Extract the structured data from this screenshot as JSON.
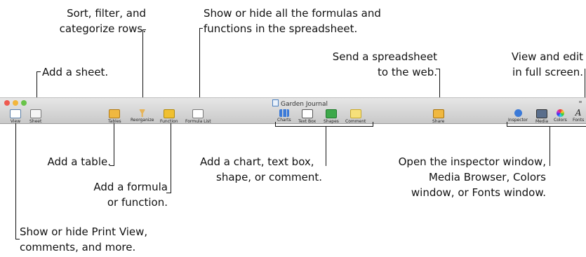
{
  "window": {
    "title": "Garden Journal"
  },
  "toolbar": {
    "view": "View",
    "sheet": "Sheet",
    "tables": "Tables",
    "reorganize": "Reorganize",
    "function": "Function",
    "formula_list": "Formula List",
    "charts": "Charts",
    "text_box": "Text Box",
    "shapes": "Shapes",
    "comment": "Comment",
    "share": "Share",
    "inspector": "Inspector",
    "media": "Media",
    "colors": "Colors",
    "fonts": "Fonts"
  },
  "callouts": {
    "sort_l1": "Sort, filter, and",
    "sort_l2": "categorize rows.",
    "formulas_l1": "Show or hide all the formulas and",
    "formulas_l2": "functions in the spreadsheet.",
    "send_l1": "Send a spreadsheet",
    "send_l2": "to the web.",
    "view_l1": "View and edit",
    "view_l2": "in full screen.",
    "add_sheet": "Add a sheet.",
    "add_table": "Add a table.",
    "add_formula_l1": "Add a formula",
    "add_formula_l2": "or function.",
    "add_chart_l1": "Add a chart, text box,",
    "add_chart_l2": "shape, or comment.",
    "inspector_l1": "Open the inspector window,",
    "inspector_l2": "Media Browser, Colors",
    "inspector_l3": "window, or Fonts window.",
    "print_l1": "Show or hide Print View,",
    "print_l2": "comments, and more."
  },
  "colors": {
    "close": "#ee5a50",
    "minimize": "#f2b63c",
    "zoom": "#68c449",
    "accent_blue": "#3b7ad8"
  }
}
